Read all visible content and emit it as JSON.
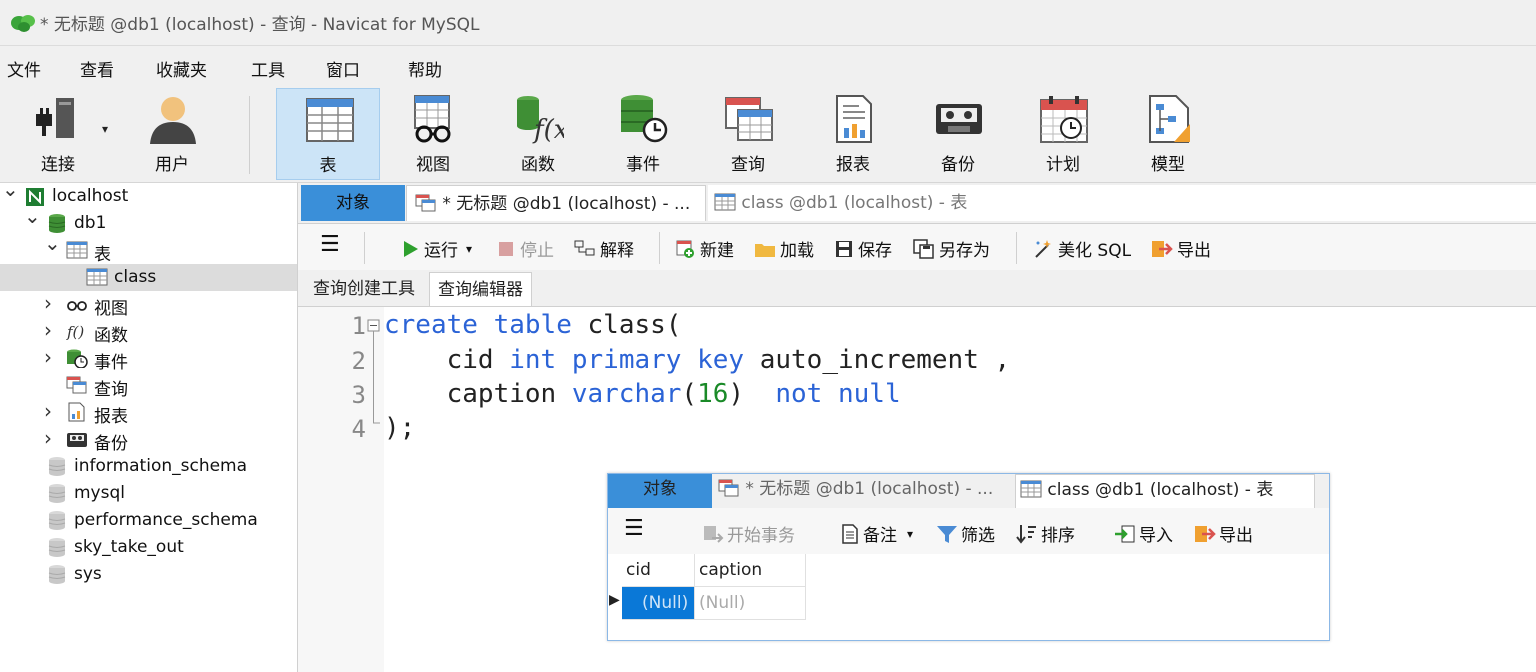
{
  "window": {
    "title": "* 无标题 @db1 (localhost) - 查询 - Navicat for MySQL"
  },
  "menu": [
    "文件",
    "查看",
    "收藏夹",
    "工具",
    "窗口",
    "帮助"
  ],
  "toolbar": [
    {
      "label": "连接",
      "icon": "connection-icon"
    },
    {
      "label": "用户",
      "icon": "user-icon"
    },
    {
      "label": "表",
      "icon": "table-icon",
      "active": true
    },
    {
      "label": "视图",
      "icon": "view-icon"
    },
    {
      "label": "函数",
      "icon": "function-icon"
    },
    {
      "label": "事件",
      "icon": "event-icon"
    },
    {
      "label": "查询",
      "icon": "query-icon"
    },
    {
      "label": "报表",
      "icon": "report-icon"
    },
    {
      "label": "备份",
      "icon": "backup-icon"
    },
    {
      "label": "计划",
      "icon": "schedule-icon"
    },
    {
      "label": "模型",
      "icon": "model-icon"
    }
  ],
  "sidebar": {
    "items": [
      {
        "label": "localhost",
        "level": 0,
        "arrow": "down",
        "icon": "server-icon"
      },
      {
        "label": "db1",
        "level": 1,
        "arrow": "down",
        "icon": "database-icon"
      },
      {
        "label": "表",
        "level": 2,
        "arrow": "down",
        "icon": "table-icon"
      },
      {
        "label": "class",
        "level": 3,
        "arrow": "",
        "icon": "table-icon",
        "selected": true
      },
      {
        "label": "视图",
        "level": 2,
        "arrow": "right",
        "icon": "view-icon"
      },
      {
        "label": "函数",
        "level": 2,
        "arrow": "right",
        "icon": "function-icon"
      },
      {
        "label": "事件",
        "level": 2,
        "arrow": "right",
        "icon": "event-icon"
      },
      {
        "label": "查询",
        "level": 2,
        "arrow": "",
        "icon": "query-icon"
      },
      {
        "label": "报表",
        "level": 2,
        "arrow": "right",
        "icon": "report-icon"
      },
      {
        "label": "备份",
        "level": 2,
        "arrow": "right",
        "icon": "backup-icon"
      },
      {
        "label": "information_schema",
        "level": 1,
        "arrow": "",
        "icon": "database-grey-icon"
      },
      {
        "label": "mysql",
        "level": 1,
        "arrow": "",
        "icon": "database-grey-icon"
      },
      {
        "label": "performance_schema",
        "level": 1,
        "arrow": "",
        "icon": "database-grey-icon"
      },
      {
        "label": "sky_take_out",
        "level": 1,
        "arrow": "",
        "icon": "database-grey-icon"
      },
      {
        "label": "sys",
        "level": 1,
        "arrow": "",
        "icon": "database-grey-icon"
      }
    ]
  },
  "doc_tabs": {
    "objects": "对象",
    "query_tab": "* 无标题 @db1 (localhost) - ...",
    "table_tab": "class @db1 (localhost) - 表"
  },
  "editor_toolbar": {
    "run": "运行",
    "stop": "停止",
    "explain": "解释",
    "new": "新建",
    "load": "加载",
    "save": "保存",
    "save_as": "另存为",
    "beautify": "美化 SQL",
    "export": "导出"
  },
  "sub_tabs": {
    "builder": "查询创建工具",
    "editor": "查询编辑器"
  },
  "code": {
    "line_numbers": [
      "1",
      "2",
      "3",
      "4"
    ],
    "l1_kw1": "create",
    "l1_kw2": "table",
    "l1_rest": " class(",
    "l2_indent": "    cid ",
    "l2_kw1": "int",
    "l2_kw2": "primary",
    "l2_kw3": "key",
    "l2_rest": " auto_increment ,",
    "l3_indent": "    caption ",
    "l3_kw1": "varchar",
    "l3_p1": "(",
    "l3_num": "16",
    "l3_p2": ") ",
    "l3_kw2": "not",
    "l3_kw3": "null",
    "l4": ");"
  },
  "popup": {
    "tabs": {
      "objects": "对象",
      "query_tab": "* 无标题 @db1 (localhost) - ...",
      "table_tab": "class @db1 (localhost) - 表"
    },
    "toolbar": {
      "begin_tx": "开始事务",
      "note": "备注",
      "filter": "筛选",
      "sort": "排序",
      "import": "导入",
      "export": "导出"
    },
    "grid": {
      "columns": [
        "cid",
        "caption"
      ],
      "rows": [
        [
          "(Null)",
          "(Null)"
        ]
      ]
    }
  },
  "colors": {
    "active_tab": "#3a8fd9",
    "keyword": "#2b63d6",
    "number": "#1a8a28",
    "selected_row": "#dcdcdc"
  }
}
